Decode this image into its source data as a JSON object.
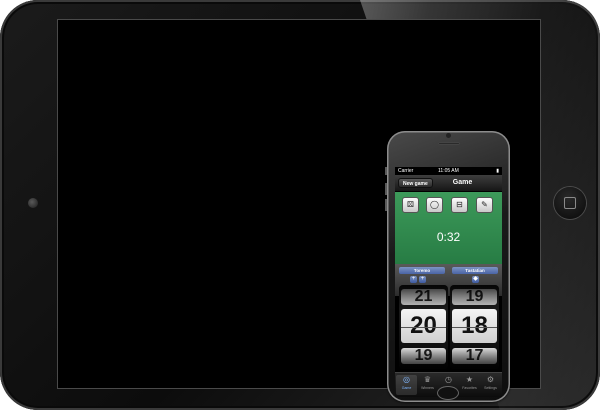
{
  "phone": {
    "status_bar": {
      "carrier": "Carrier",
      "time": "11:05 AM",
      "battery": "▮"
    },
    "nav": {
      "button_label": "New game",
      "title": "Game"
    },
    "toolbar": {
      "buttons": [
        {
          "icon": "dice-icon",
          "glyph": "⚄"
        },
        {
          "icon": "circle-icon",
          "glyph": "◯"
        },
        {
          "icon": "domino-icon",
          "glyph": "⊟"
        },
        {
          "icon": "note-icon",
          "glyph": "✎"
        }
      ]
    },
    "timer": "0:32",
    "players": {
      "left": {
        "name": "Toremo",
        "buttons": [
          "+",
          "+"
        ]
      },
      "right": {
        "name": "Tastatian",
        "buttons": [
          "◆"
        ]
      }
    },
    "scores": {
      "left": {
        "prev": "21",
        "value": "20",
        "next": "19"
      },
      "right": {
        "prev": "19",
        "value": "18",
        "next": "17"
      }
    },
    "tabs": [
      {
        "icon": "game-icon",
        "glyph": "◎",
        "label": "Game"
      },
      {
        "icon": "trophy-icon",
        "glyph": "♛",
        "label": "Winners"
      },
      {
        "icon": "clock-icon",
        "glyph": "◷",
        "label": "History"
      },
      {
        "icon": "star-icon",
        "glyph": "★",
        "label": "Favorites"
      },
      {
        "icon": "gear-icon",
        "glyph": "⚙",
        "label": "Settings"
      }
    ],
    "active_tab": "Game"
  },
  "colors": {
    "game_green": "#2f8a4d",
    "player_blue": "#5b74b4",
    "device_black": "#0c0c0c"
  }
}
